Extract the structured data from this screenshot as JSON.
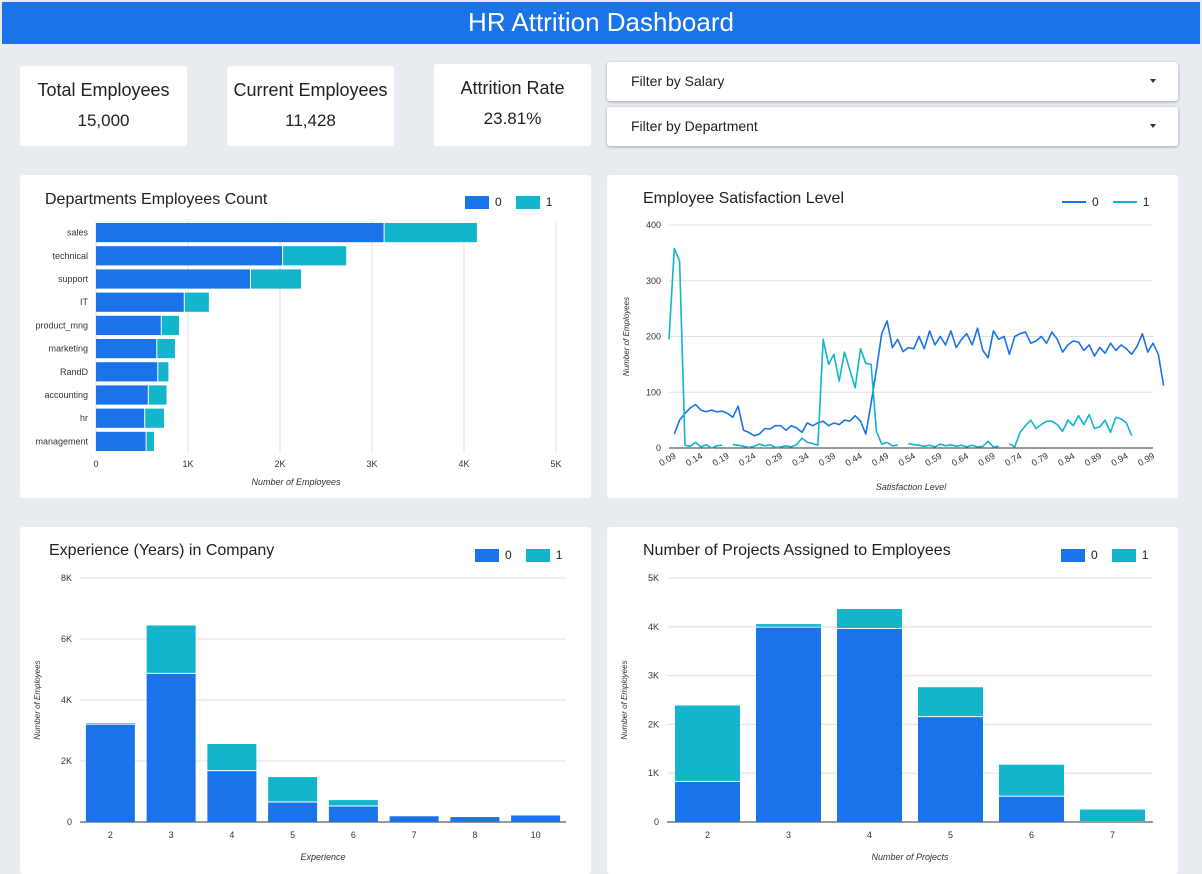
{
  "header": {
    "title": "HR Attrition Dashboard"
  },
  "kpis": [
    {
      "label": "Total Employees",
      "value": "15,000"
    },
    {
      "label": "Current Employees",
      "value": "11,428"
    },
    {
      "label": "Attrition Rate",
      "value": "23.81%"
    }
  ],
  "filters": [
    {
      "label": "Filter by Salary"
    },
    {
      "label": "Filter by Department"
    }
  ],
  "colors": {
    "series0": "#1a73e8",
    "series1": "#12b5cb",
    "header": "#1a73e8"
  },
  "legend": {
    "series0": "0",
    "series1": "1"
  },
  "chart_data": [
    {
      "id": "departments",
      "type": "bar",
      "orientation": "horizontal",
      "stacked": true,
      "title": "Departments Employees Count",
      "xlabel": "Number of Employees",
      "ylabel": "",
      "xlim": [
        0,
        5000
      ],
      "xticks": [
        "0",
        "1K",
        "2K",
        "3K",
        "4K",
        "5K"
      ],
      "categories": [
        "sales",
        "technical",
        "support",
        "IT",
        "product_mng",
        "marketing",
        "RandD",
        "accounting",
        "hr",
        "management"
      ],
      "series": [
        {
          "name": "0",
          "values": [
            3126,
            2023,
            1674,
            954,
            704,
            655,
            666,
            563,
            524,
            539
          ]
        },
        {
          "name": "1",
          "values": [
            1014,
            697,
            555,
            273,
            198,
            203,
            121,
            204,
            215,
            91
          ]
        }
      ],
      "legend_position": "top-right"
    },
    {
      "id": "satisfaction",
      "type": "line",
      "title": "Employee Satisfaction Level",
      "xlabel": "Satisfaction Level",
      "ylabel": "Number of Employees",
      "ylim": [
        0,
        400
      ],
      "yticks": [
        "0",
        "100",
        "200",
        "300",
        "400"
      ],
      "xticks": [
        "0.09",
        "0.14",
        "0.19",
        "0.24",
        "0.29",
        "0.34",
        "0.39",
        "0.44",
        "0.49",
        "0.54",
        "0.59",
        "0.64",
        "0.69",
        "0.74",
        "0.79",
        "0.84",
        "0.89",
        "0.94",
        "0.99"
      ],
      "x_range": [
        0.09,
        1.0
      ],
      "series": [
        {
          "name": "0",
          "points": [
            [
              0.1,
              25
            ],
            [
              0.11,
              50
            ],
            [
              0.12,
              62
            ],
            [
              0.13,
              72
            ],
            [
              0.14,
              78
            ],
            [
              0.15,
              68
            ],
            [
              0.16,
              65
            ],
            [
              0.17,
              68
            ],
            [
              0.18,
              65
            ],
            [
              0.19,
              66
            ],
            [
              0.2,
              62
            ],
            [
              0.21,
              55
            ],
            [
              0.22,
              75
            ],
            [
              0.23,
              32
            ],
            [
              0.24,
              28
            ],
            [
              0.25,
              22
            ],
            [
              0.26,
              25
            ],
            [
              0.27,
              35
            ],
            [
              0.28,
              34
            ],
            [
              0.29,
              40
            ],
            [
              0.3,
              40
            ],
            [
              0.31,
              32
            ],
            [
              0.32,
              40
            ],
            [
              0.33,
              36
            ],
            [
              0.34,
              28
            ],
            [
              0.35,
              45
            ],
            [
              0.36,
              40
            ],
            [
              0.37,
              45
            ],
            [
              0.38,
              48
            ],
            [
              0.39,
              40
            ],
            [
              0.4,
              45
            ],
            [
              0.41,
              42
            ],
            [
              0.42,
              50
            ],
            [
              0.43,
              48
            ],
            [
              0.44,
              58
            ],
            [
              0.45,
              48
            ],
            [
              0.46,
              25
            ],
            [
              0.47,
              80
            ],
            [
              0.48,
              140
            ],
            [
              0.49,
              205
            ],
            [
              0.5,
              228
            ],
            [
              0.51,
              180
            ],
            [
              0.52,
              195
            ],
            [
              0.53,
              173
            ],
            [
              0.54,
              180
            ],
            [
              0.55,
              178
            ],
            [
              0.56,
              200
            ],
            [
              0.57,
              178
            ],
            [
              0.58,
              210
            ],
            [
              0.59,
              185
            ],
            [
              0.6,
              200
            ],
            [
              0.61,
              185
            ],
            [
              0.62,
              210
            ],
            [
              0.63,
              180
            ],
            [
              0.64,
              195
            ],
            [
              0.65,
              205
            ],
            [
              0.66,
              185
            ],
            [
              0.67,
              215
            ],
            [
              0.68,
              175
            ],
            [
              0.69,
              162
            ],
            [
              0.7,
              210
            ],
            [
              0.71,
              195
            ],
            [
              0.72,
              200
            ],
            [
              0.73,
              168
            ],
            [
              0.74,
              200
            ],
            [
              0.75,
              205
            ],
            [
              0.76,
              208
            ],
            [
              0.77,
              188
            ],
            [
              0.78,
              192
            ],
            [
              0.79,
              200
            ],
            [
              0.8,
              188
            ],
            [
              0.81,
              208
            ],
            [
              0.82,
              195
            ],
            [
              0.83,
              172
            ],
            [
              0.84,
              185
            ],
            [
              0.85,
              192
            ],
            [
              0.86,
              190
            ],
            [
              0.87,
              175
            ],
            [
              0.88,
              185
            ],
            [
              0.89,
              165
            ],
            [
              0.9,
              180
            ],
            [
              0.91,
              170
            ],
            [
              0.92,
              188
            ],
            [
              0.93,
              175
            ],
            [
              0.94,
              185
            ],
            [
              0.95,
              178
            ],
            [
              0.96,
              168
            ],
            [
              0.97,
              182
            ],
            [
              0.98,
              205
            ],
            [
              0.99,
              172
            ],
            [
              1.0,
              188
            ],
            [
              1.01,
              168
            ],
            [
              1.02,
              112
            ]
          ]
        },
        {
          "name": "1",
          "points": [
            [
              0.09,
              195
            ],
            [
              0.1,
              358
            ],
            [
              0.11,
              335
            ],
            [
              0.12,
              5
            ],
            [
              0.13,
              3
            ],
            [
              0.14,
              10
            ],
            [
              0.15,
              2
            ],
            [
              0.16,
              6
            ],
            [
              0.17,
              0
            ],
            [
              0.18,
              4
            ],
            [
              0.19,
              5
            ],
            [
              0.2,
              null
            ],
            [
              0.21,
              6
            ],
            [
              0.22,
              5
            ],
            [
              0.23,
              3
            ],
            [
              0.24,
              1
            ],
            [
              0.25,
              3
            ],
            [
              0.26,
              7
            ],
            [
              0.27,
              4
            ],
            [
              0.28,
              6
            ],
            [
              0.29,
              1
            ],
            [
              0.3,
              2
            ],
            [
              0.31,
              4
            ],
            [
              0.32,
              2
            ],
            [
              0.33,
              6
            ],
            [
              0.34,
              18
            ],
            [
              0.35,
              10
            ],
            [
              0.36,
              8
            ],
            [
              0.37,
              5
            ],
            [
              0.38,
              195
            ],
            [
              0.39,
              150
            ],
            [
              0.4,
              168
            ],
            [
              0.41,
              120
            ],
            [
              0.42,
              172
            ],
            [
              0.43,
              140
            ],
            [
              0.44,
              108
            ],
            [
              0.45,
              178
            ],
            [
              0.46,
              152
            ],
            [
              0.47,
              150
            ],
            [
              0.48,
              30
            ],
            [
              0.49,
              7
            ],
            [
              0.5,
              10
            ],
            [
              0.51,
              4
            ],
            [
              0.52,
              5
            ],
            [
              0.53,
              null
            ],
            [
              0.54,
              8
            ],
            [
              0.55,
              6
            ],
            [
              0.56,
              5
            ],
            [
              0.57,
              3
            ],
            [
              0.58,
              5
            ],
            [
              0.59,
              2
            ],
            [
              0.6,
              7
            ],
            [
              0.61,
              4
            ],
            [
              0.62,
              6
            ],
            [
              0.63,
              3
            ],
            [
              0.64,
              5
            ],
            [
              0.65,
              2
            ],
            [
              0.66,
              5
            ],
            [
              0.67,
              2
            ],
            [
              0.68,
              3
            ],
            [
              0.69,
              12
            ],
            [
              0.7,
              2
            ],
            [
              0.71,
              3
            ],
            [
              0.72,
              null
            ],
            [
              0.73,
              8
            ],
            [
              0.74,
              2
            ],
            [
              0.75,
              28
            ],
            [
              0.76,
              40
            ],
            [
              0.77,
              50
            ],
            [
              0.78,
              35
            ],
            [
              0.79,
              42
            ],
            [
              0.8,
              48
            ],
            [
              0.81,
              48
            ],
            [
              0.82,
              42
            ],
            [
              0.83,
              30
            ],
            [
              0.84,
              50
            ],
            [
              0.85,
              40
            ],
            [
              0.86,
              58
            ],
            [
              0.87,
              42
            ],
            [
              0.88,
              60
            ],
            [
              0.89,
              35
            ],
            [
              0.9,
              38
            ],
            [
              0.91,
              50
            ],
            [
              0.92,
              28
            ],
            [
              0.93,
              55
            ],
            [
              0.94,
              52
            ],
            [
              0.95,
              45
            ],
            [
              0.96,
              22
            ]
          ]
        }
      ],
      "legend_position": "top-right"
    },
    {
      "id": "experience",
      "type": "bar",
      "stacked": true,
      "title": "Experience (Years) in Company",
      "xlabel": "Experience",
      "ylabel": "Number of Employees",
      "ylim": [
        0,
        8000
      ],
      "yticks": [
        "0",
        "2K",
        "4K",
        "6K",
        "8K"
      ],
      "categories": [
        "2",
        "3",
        "4",
        "5",
        "6",
        "7",
        "8",
        "10"
      ],
      "series": [
        {
          "name": "0",
          "values": [
            3191,
            4857,
            1667,
            640,
            509,
            188,
            162,
            214
          ]
        },
        {
          "name": "1",
          "values": [
            53,
            1586,
            890,
            833,
            209,
            0,
            0,
            0
          ]
        }
      ],
      "legend_position": "top-right"
    },
    {
      "id": "projects",
      "type": "bar",
      "stacked": true,
      "title": "Number of Projects Assigned to Employees",
      "xlabel": "Number of Projects",
      "ylabel": "Number of Employees",
      "ylim": [
        0,
        5000
      ],
      "yticks": [
        "0",
        "1K",
        "2K",
        "3K",
        "4K",
        "5K"
      ],
      "categories": [
        "2",
        "3",
        "4",
        "5",
        "6",
        "7"
      ],
      "series": [
        {
          "name": "0",
          "values": [
            821,
            3983,
            3956,
            2149,
            519,
            0
          ]
        },
        {
          "name": "1",
          "values": [
            1567,
            72,
            409,
            612,
            655,
            256
          ]
        }
      ],
      "legend_position": "top-right"
    }
  ]
}
